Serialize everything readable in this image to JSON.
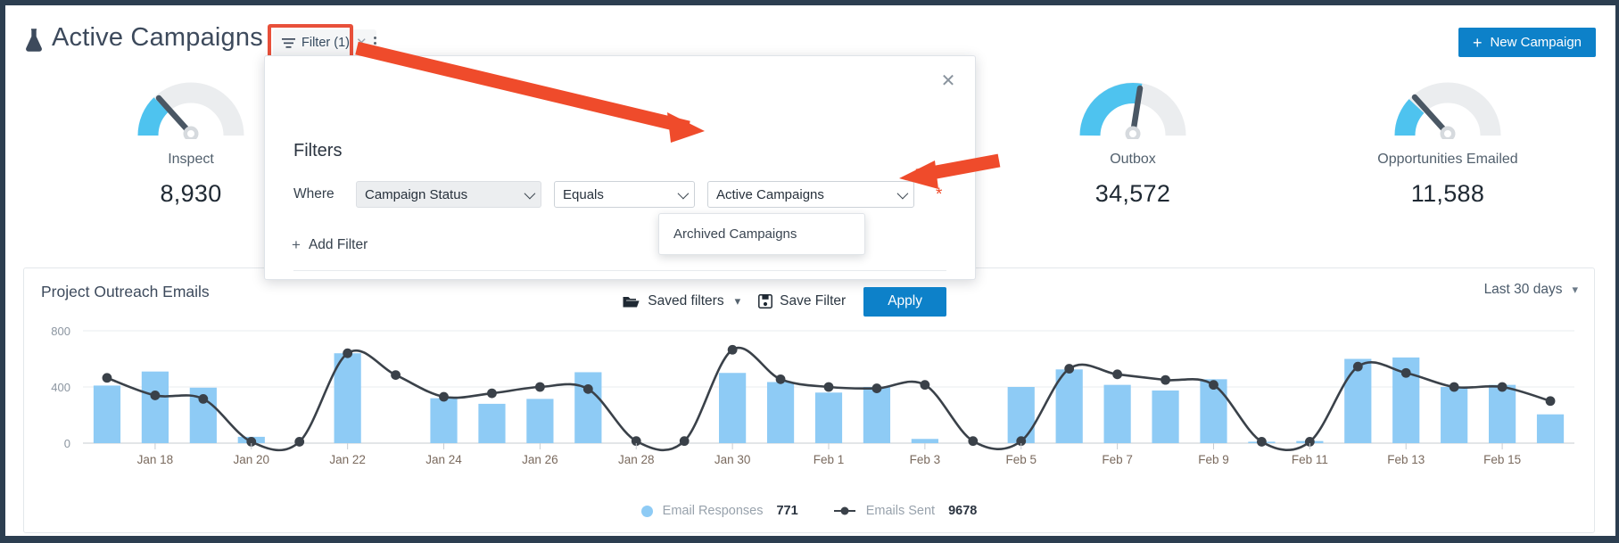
{
  "header": {
    "title": "Active Campaigns",
    "flask_icon": "flask-icon",
    "filter_chip": {
      "label": "Filter (1)",
      "filter_icon": "filter-icon",
      "clear_icon": "close-icon"
    },
    "kebab_icon": "more-vertical-icon",
    "new_campaign": {
      "label": "New Campaign",
      "plus": "+",
      "color": "#0d81c9"
    }
  },
  "kpis": [
    {
      "label": "Inspect",
      "value": "8,930",
      "fill": 0.22
    },
    {
      "label": "Outbox",
      "value": "34,572",
      "fill": 0.63
    },
    {
      "label": "Opportunities Emailed",
      "value": "11,588",
      "fill": 0.2
    }
  ],
  "filter_popover": {
    "title": "Filters",
    "close_icon": "close-icon",
    "where_label": "Where",
    "field_value": "Campaign Status",
    "operator_value": "Equals",
    "value_value": "Active Campaigns",
    "required_marker": "*",
    "dropdown_options": [
      "Archived Campaigns"
    ],
    "add_filter_label": "Add Filter",
    "add_filter_plus": "+",
    "saved_filters_label": "Saved filters",
    "saved_filters_icon": "folder-icon",
    "save_filter_label": "Save Filter",
    "save_filter_icon": "floppy-disk-icon",
    "apply_label": "Apply"
  },
  "chart_card": {
    "title": "Project Outreach Emails",
    "range_label": "Last 30 days",
    "range_chevron": "chevron-down-icon",
    "legend": [
      {
        "name": "Email Responses",
        "value": "771",
        "marker": "dot",
        "color": "#8ecbf5"
      },
      {
        "name": "Emails Sent",
        "value": "9678",
        "marker": "line",
        "color": "#3a4149"
      }
    ]
  },
  "chart_data": {
    "type": "bar",
    "title": "Project Outreach Emails",
    "xlabel": "",
    "ylabel": "",
    "ylim": [
      0,
      800
    ],
    "yticks": [
      0,
      400,
      800
    ],
    "grid": true,
    "legend_position": "bottom",
    "x": [
      "Jan 17",
      "Jan 18",
      "Jan 19",
      "Jan 20",
      "Jan 21",
      "Jan 22",
      "Jan 23",
      "Jan 24",
      "Jan 25",
      "Jan 26",
      "Jan 27",
      "Jan 28",
      "Jan 29",
      "Jan 30",
      "Jan 31",
      "Feb 1",
      "Feb 2",
      "Feb 3",
      "Feb 4",
      "Feb 5",
      "Feb 6",
      "Feb 7",
      "Feb 8",
      "Feb 9",
      "Feb 10",
      "Feb 11",
      "Feb 12",
      "Feb 13",
      "Feb 14",
      "Feb 15",
      "Feb 16"
    ],
    "xtick_labels": [
      "Jan 18",
      "Jan 20",
      "Jan 22",
      "Jan 24",
      "Jan 26",
      "Jan 28",
      "Jan 30",
      "Feb 1",
      "Feb 3",
      "Feb 5",
      "Feb 7",
      "Feb 9",
      "Feb 11",
      "Feb 13",
      "Feb 15"
    ],
    "series": [
      {
        "name": "Email Responses",
        "type": "bar",
        "color": "#8ecbf5",
        "total": "771",
        "values": [
          410,
          510,
          395,
          45,
          0,
          640,
          0,
          320,
          280,
          315,
          505,
          0,
          0,
          500,
          435,
          360,
          400,
          30,
          0,
          400,
          525,
          415,
          375,
          455,
          10,
          15,
          600,
          610,
          400,
          415,
          205
        ]
      },
      {
        "name": "Emails Sent",
        "type": "line",
        "color": "#3a4149",
        "total": "9678",
        "values": [
          465,
          340,
          315,
          10,
          10,
          640,
          485,
          330,
          355,
          400,
          385,
          15,
          15,
          665,
          455,
          400,
          390,
          415,
          15,
          15,
          530,
          490,
          450,
          415,
          10,
          10,
          545,
          500,
          400,
          400,
          300
        ]
      }
    ]
  }
}
